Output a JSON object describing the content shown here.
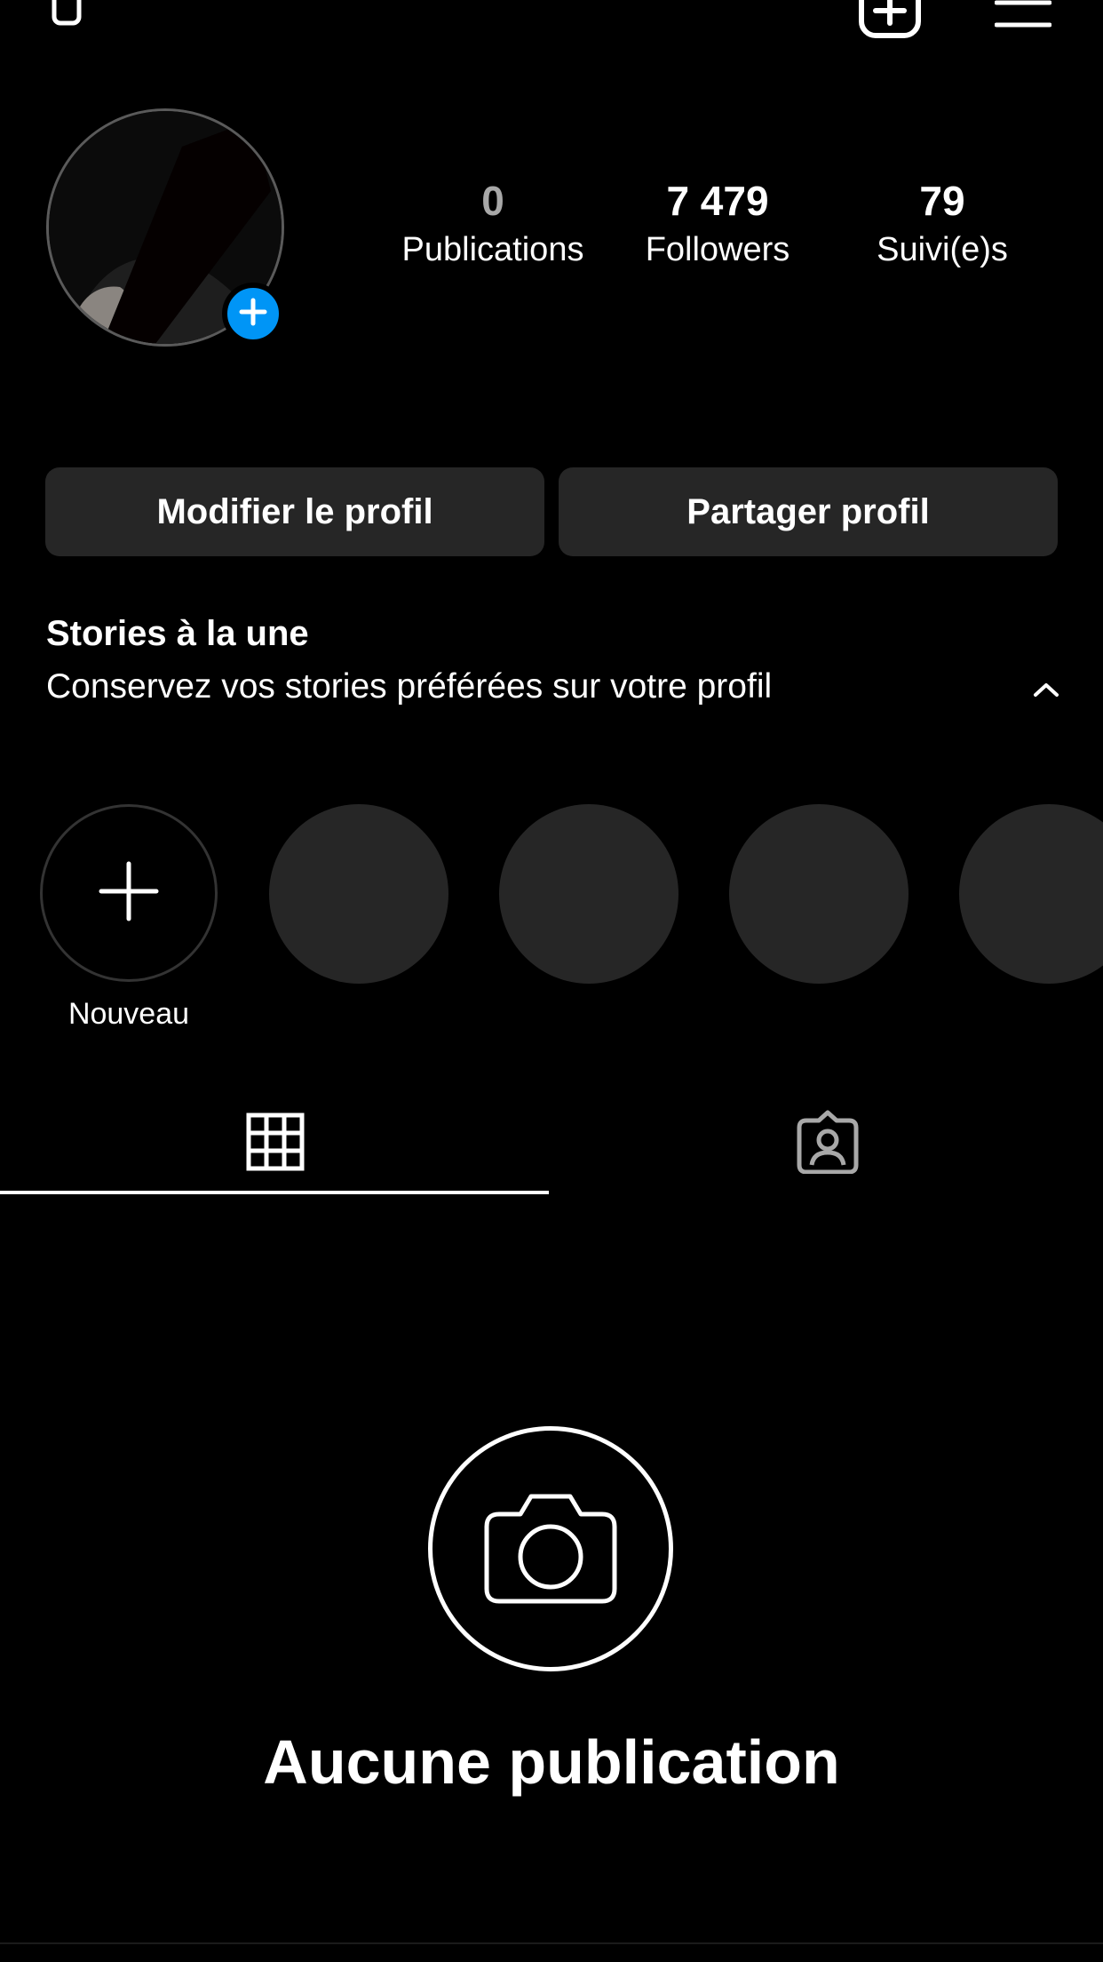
{
  "icons": {
    "top_left": "threads-icon",
    "create": "plus-square-icon",
    "menu": "hamburger-menu-icon",
    "avatar_add": "plus-icon",
    "chevron": "chevron-up-icon",
    "new_highlight": "plus-icon",
    "grid_tab": "grid-icon",
    "tagged_tab": "tagged-person-icon",
    "empty": "camera-icon"
  },
  "stats": [
    {
      "value": "0",
      "label": "Publications"
    },
    {
      "value": "7 479",
      "label": "Followers"
    },
    {
      "value": "79",
      "label": "Suivi(e)s"
    }
  ],
  "buttons": {
    "edit_profile": "Modifier le profil",
    "share_profile": "Partager profil"
  },
  "highlights": {
    "title": "Stories à la une",
    "subtitle": "Conservez vos stories préférées sur votre profil",
    "new_label": "Nouveau"
  },
  "empty_state": {
    "title": "Aucune publication"
  },
  "colors": {
    "background": "#000000",
    "button": "#262626",
    "accent_blue": "#0095f6"
  }
}
